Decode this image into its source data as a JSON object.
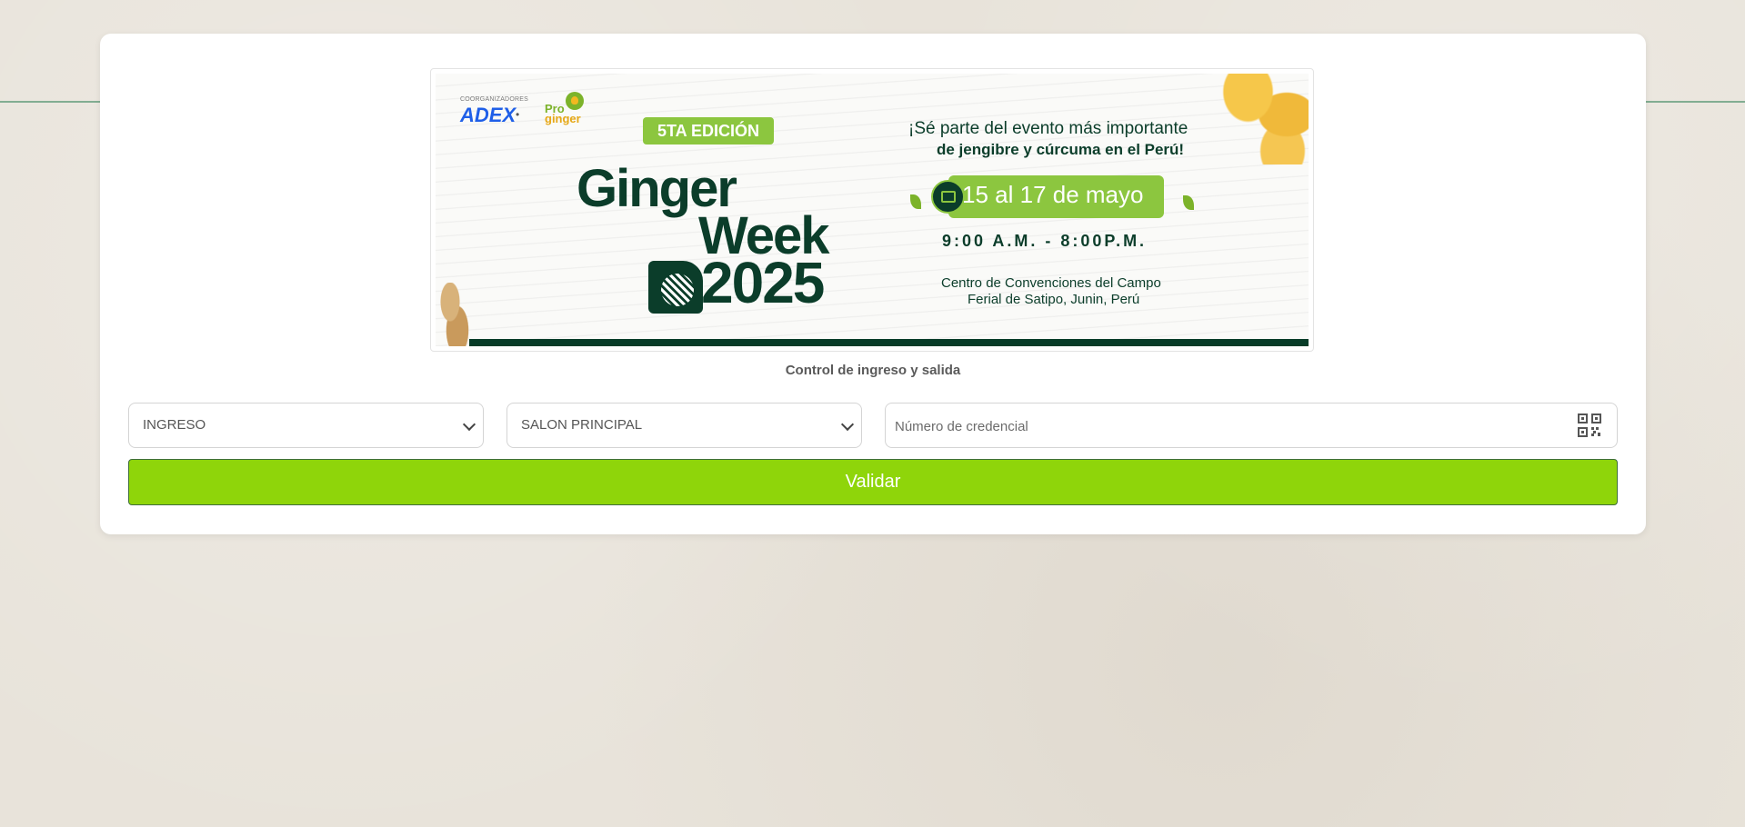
{
  "banner": {
    "coorganizers_label": "COORGANIZADORES",
    "adex_logo": "ADEX",
    "separator": "•",
    "proginger_logo_line1": "Pro",
    "proginger_logo_line2": "ginger",
    "edition": "5TA EDICIÓN",
    "title_line1": "Ginger",
    "title_line2": "Week",
    "title_year": "2025",
    "tagline_line1": "¡Sé parte del evento más importante",
    "tagline_line2": "de jengibre y cúrcuma en el Perú!",
    "dates": "15 al 17 de mayo",
    "hours": "9:00 A.M. - 8:00P.M.",
    "venue_line1": "Centro de Convenciones del Campo",
    "venue_line2": "Ferial de Satipo, Junin, Perú",
    "calendar_icon": "calendar-icon"
  },
  "caption": "Control de ingreso y salida",
  "form": {
    "movement_value": "INGRESO",
    "room_value": "SALON PRINCIPAL",
    "credential_value": "",
    "credential_placeholder": "Número de credencial",
    "qr_icon": "qr-code-icon",
    "submit_label": "Validar"
  },
  "colors": {
    "primary_button": "#8fd50a",
    "brand_dark_green": "#0b3d2a",
    "brand_light_green": "#8cc63f",
    "adex_blue": "#1f5fe8"
  }
}
